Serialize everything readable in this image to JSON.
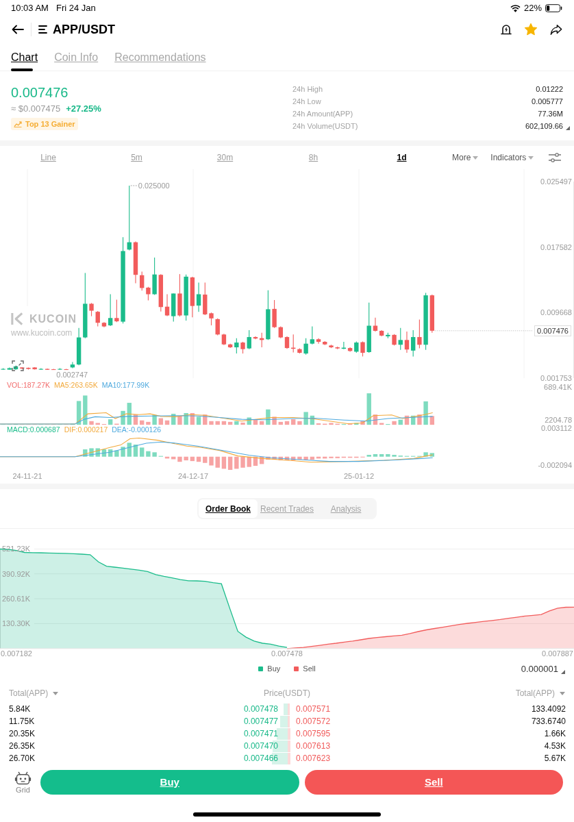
{
  "status_bar": {
    "time": "10:03 AM",
    "date": "Fri 24 Jan",
    "battery": "22%"
  },
  "header": {
    "pair": "APP/USDT",
    "favorite": true
  },
  "tabs": [
    {
      "label": "Chart",
      "selected": true
    },
    {
      "label": "Coin Info",
      "selected": false
    },
    {
      "label": "Recommendations",
      "selected": false
    }
  ],
  "ticker": {
    "last": "0.007476",
    "fiat": "≈ $0.007475",
    "change": "+27.25%",
    "badge": "Top 13 Gainer",
    "stats": [
      {
        "label": "24h High",
        "value": "0.01222"
      },
      {
        "label": "24h Low",
        "value": "0.005777"
      },
      {
        "label": "24h Amount(APP)",
        "value": "77.36M"
      },
      {
        "label": "24h Volume(USDT)",
        "value": "602,109.66"
      }
    ]
  },
  "intervals": [
    {
      "label": "Line",
      "selected": false
    },
    {
      "label": "5m",
      "selected": false
    },
    {
      "label": "30m",
      "selected": false
    },
    {
      "label": "8h",
      "selected": false
    },
    {
      "label": "1d",
      "selected": true
    }
  ],
  "chart_menus": [
    "More",
    "Indicators"
  ],
  "price_chart": {
    "chart_data": {
      "type": "candlestick",
      "categories": [
        null,
        null,
        null,
        null,
        null,
        null,
        null,
        null,
        null,
        null,
        null,
        null,
        null,
        null,
        null,
        null,
        null,
        null,
        null,
        null,
        null,
        null,
        null,
        null,
        null,
        null,
        null,
        null,
        null,
        null,
        null,
        null,
        null,
        null,
        null,
        null,
        null,
        null,
        null,
        null,
        null,
        null,
        null,
        null,
        null,
        null,
        null,
        null,
        null,
        null,
        null,
        null,
        null,
        null,
        null,
        null,
        null,
        null,
        null,
        null,
        null,
        null,
        null,
        null,
        null,
        null,
        null,
        null,
        null,
        null,
        null,
        null,
        null,
        null,
        null,
        null,
        null,
        null,
        null,
        null,
        null,
        null,
        null,
        null,
        null,
        null,
        null,
        null,
        null,
        null,
        null
      ],
      "ohlc": [
        [
          0.002777,
          0.002954,
          0.00277,
          0.002866
        ],
        [
          0.002777,
          0.003043,
          0.00276,
          0.002954
        ],
        [
          0.002822,
          0.003264,
          0.002755,
          0.003175
        ],
        [
          0.003043,
          0.003087,
          0.002822,
          0.00291
        ],
        [
          0.002999,
          0.003043,
          0.002777,
          0.002866
        ],
        [
          0.003043,
          0.003087,
          0.002777,
          0.002822
        ],
        [
          0.002777,
          0.002954,
          0.002752,
          0.002866
        ],
        [
          0.002866,
          0.00291,
          0.00275,
          0.00276
        ],
        [
          0.002822,
          0.002866,
          0.002747,
          0.00276
        ],
        [
          0.002777,
          0.002954,
          0.002755,
          0.002866
        ],
        [
          0.002822,
          0.002866,
          0.00275,
          0.002777
        ],
        [
          0.003043,
          0.003706,
          0.002954,
          0.003396
        ],
        [
          0.003396,
          0.007817,
          0.003308,
          0.006668
        ],
        [
          0.006668,
          0.014449,
          0.00658,
          0.010735
        ],
        [
          0.010735,
          0.010824,
          0.009232,
          0.009895
        ],
        [
          0.009763,
          0.009851,
          0.007994,
          0.008436
        ],
        [
          0.008436,
          0.008525,
          0.007906,
          0.007994
        ],
        [
          0.008127,
          0.011885,
          0.008039,
          0.009011
        ],
        [
          0.009011,
          0.011222,
          0.008525,
          0.008613
        ],
        [
          0.008569,
          0.018782,
          0.008348,
          0.017102
        ],
        [
          0.017278,
          0.025,
          0.01719,
          0.018163
        ],
        [
          0.018163,
          0.018251,
          0.013211,
          0.014228
        ],
        [
          0.014184,
          0.014626,
          0.012327,
          0.012637
        ],
        [
          0.012681,
          0.012769,
          0.011133,
          0.011885
        ],
        [
          0.011885,
          0.016306,
          0.011796,
          0.014272
        ],
        [
          0.014228,
          0.014316,
          0.009807,
          0.010337
        ],
        [
          0.010382,
          0.011885,
          0.009232,
          0.009321
        ],
        [
          0.009232,
          0.011973,
          0.008569,
          0.011973
        ],
        [
          0.011973,
          0.014316,
          0.009188,
          0.009321
        ],
        [
          0.009321,
          0.014272,
          0.008702,
          0.014007
        ],
        [
          0.013918,
          0.014007,
          0.0091,
          0.01047
        ],
        [
          0.010514,
          0.0133,
          0.009763,
          0.011885
        ],
        [
          0.011841,
          0.0133,
          0.009365,
          0.009453
        ],
        [
          0.009586,
          0.009674,
          0.008127,
          0.008967
        ],
        [
          0.008879,
          0.008967,
          0.006933,
          0.007022
        ],
        [
          0.007022,
          0.00711,
          0.00574,
          0.005828
        ],
        [
          0.005828,
          0.005916,
          0.005386,
          0.005474
        ],
        [
          0.005474,
          0.00658,
          0.004723,
          0.006049
        ],
        [
          0.006049,
          0.006137,
          0.004723,
          0.005253
        ],
        [
          0.005342,
          0.007552,
          0.005253,
          0.006712
        ],
        [
          0.006712,
          0.006801,
          0.006447,
          0.006535
        ],
        [
          0.00658,
          0.007243,
          0.005474,
          0.006359
        ],
        [
          0.006447,
          0.012371,
          0.006359,
          0.010072
        ],
        [
          0.010116,
          0.011177,
          0.007817,
          0.007906
        ],
        [
          0.007906,
          0.007994,
          0.00658,
          0.006668
        ],
        [
          0.006712,
          0.006801,
          0.005298,
          0.005386
        ],
        [
          0.00543,
          0.007022,
          0.004855,
          0.005298
        ],
        [
          0.005253,
          0.005342,
          0.004723,
          0.004811
        ],
        [
          0.004723,
          0.00658,
          0.00459,
          0.005916
        ],
        [
          0.005916,
          0.007994,
          0.005828,
          0.006447
        ],
        [
          0.006447,
          0.00658,
          0.005916,
          0.006137
        ],
        [
          0.006137,
          0.006226,
          0.00574,
          0.005828
        ],
        [
          0.005695,
          0.005784,
          0.005386,
          0.005474
        ],
        [
          0.005474,
          0.005563,
          0.005253,
          0.005342
        ],
        [
          0.005298,
          0.006137,
          0.005253,
          0.00543
        ],
        [
          0.005386,
          0.005474,
          0.004944,
          0.005032
        ],
        [
          0.004944,
          0.006182,
          0.004811,
          0.006049
        ],
        [
          0.006093,
          0.006182,
          0.004369,
          0.004811
        ],
        [
          0.004899,
          0.010868,
          0.004811,
          0.008083
        ],
        [
          0.008083,
          0.009055,
          0.007375,
          0.007464
        ],
        [
          0.007464,
          0.007552,
          0.006801,
          0.006889
        ],
        [
          0.006801,
          0.007243,
          0.00658,
          0.006977
        ],
        [
          0.006977,
          0.007066,
          0.005695,
          0.005784
        ],
        [
          0.005784,
          0.007817,
          0.005165,
          0.006359
        ],
        [
          0.006359,
          0.007375,
          0.004811,
          0.005209
        ],
        [
          0.005076,
          0.007552,
          0.004369,
          0.006712
        ],
        [
          0.006712,
          0.008834,
          0.005342,
          0.005784
        ],
        [
          0.005784,
          0.012062,
          0.005165,
          0.011752
        ],
        [
          0.011752,
          0.011841,
          0.007243,
          0.007476
        ],
        null,
        null,
        null,
        null,
        null,
        null,
        null,
        null,
        null,
        null,
        null,
        null,
        null,
        null,
        null,
        null,
        null,
        null,
        null,
        null,
        null,
        null
      ],
      "ylim": [
        0.001753,
        0.025497
      ],
      "yticks": [
        {
          "value": 0.025497,
          "label": "0.025497"
        },
        {
          "value": 0.017582,
          "label": "0.017582"
        },
        {
          "value": 0.009668,
          "label": "0.009668"
        },
        {
          "value": 0.001753,
          "label": "0.001753"
        }
      ],
      "ref_lines": [
        {
          "axis": "y",
          "value": 0.007476,
          "label": "0.007476"
        }
      ],
      "annotations": [
        "0.025000",
        "0.002747"
      ]
    },
    "watermark": {
      "brand": "KUCOIN",
      "url": "www.kucoin.com"
    }
  },
  "volume": {
    "readouts": [
      {
        "text": "VOL:187.27K",
        "color": "#f26b6b"
      },
      {
        "text": "MA5:263.65K",
        "color": "#f2a93b"
      },
      {
        "text": "MA10:177.99K",
        "color": "#4ea9de"
      }
    ],
    "axis_labels": [
      "689.41K",
      "2204.78"
    ]
  },
  "macd": {
    "readouts": [
      {
        "text": "MACD:0.000687",
        "color": "#1bbc8b"
      },
      {
        "text": "DIF:0.000217",
        "color": "#f2a93b"
      },
      {
        "text": "DEA:-0.000126",
        "color": "#4ea9de"
      }
    ],
    "axis_labels": [
      "0.003112",
      "-0.002094"
    ]
  },
  "dates": [
    "24-11-21",
    "24-12-17",
    "25-01-12"
  ],
  "book_tabs": [
    {
      "label": "Order Book",
      "selected": true
    },
    {
      "label": "Recent Trades",
      "selected": false
    },
    {
      "label": "Analysis",
      "selected": false
    }
  ],
  "depth_chart": {
    "chart_data": {
      "type": "area",
      "categories": [
        null,
        null,
        "0.007182",
        null,
        null,
        null,
        null,
        null,
        null,
        null,
        null,
        null,
        null,
        null,
        null,
        null,
        null,
        null,
        null,
        null,
        null,
        null,
        null,
        null,
        null,
        null,
        null,
        null,
        null,
        null,
        null,
        null,
        null,
        null,
        null,
        "0.007478",
        null,
        null,
        null,
        null,
        null,
        null,
        null,
        null,
        null,
        null,
        null,
        null,
        null,
        null,
        null,
        null,
        null,
        null,
        null,
        null,
        null,
        null,
        null,
        null,
        null,
        null,
        null,
        null,
        null,
        null,
        null,
        null,
        "0.007887",
        null,
        null
      ],
      "series": [
        {
          "name": "Buy",
          "color": "#1bbc8b",
          "values": [
            521,
            519,
            513,
            503,
            502,
            501,
            500,
            499,
            498,
            496,
            494,
            491,
            454,
            431,
            426,
            421,
            416,
            410,
            403,
            387,
            378,
            370,
            361,
            355,
            354,
            352,
            345,
            339,
            213,
            90,
            60,
            39,
            28,
            23,
            13,
            6,
            null,
            null,
            null,
            null,
            null,
            null,
            null,
            null,
            null,
            null,
            null,
            null,
            null,
            null,
            null,
            null,
            null,
            null,
            null,
            null,
            null,
            null,
            null,
            null,
            null,
            null,
            null,
            null,
            null,
            null,
            null,
            null,
            null,
            null,
            null
          ]
        },
        {
          "name": "Sell",
          "color": "#f25c5c",
          "values": [
            null,
            null,
            null,
            null,
            null,
            null,
            null,
            null,
            null,
            null,
            null,
            null,
            null,
            null,
            null,
            null,
            null,
            null,
            null,
            null,
            null,
            null,
            null,
            null,
            null,
            null,
            null,
            null,
            null,
            null,
            null,
            null,
            null,
            null,
            null,
            0,
            3,
            6,
            11,
            17,
            23,
            28,
            34,
            39,
            46,
            53,
            58,
            62,
            66,
            70,
            79,
            89,
            98,
            105,
            112,
            119,
            126,
            132,
            137,
            142,
            147,
            152,
            158,
            164,
            170,
            174,
            178,
            197,
            211,
            216,
            217
          ]
        }
      ],
      "ylim": [
        0,
        521.23
      ],
      "yticks": [
        {
          "value": 130.3,
          "label": "130.30K"
        },
        {
          "value": 260.61,
          "label": "260.61K"
        },
        {
          "value": 390.92,
          "label": "390.92K"
        },
        {
          "value": 521.23,
          "label": "521.23K"
        }
      ],
      "grid": true,
      "legend": "bottom"
    }
  },
  "precision": "0.000001",
  "order_book": {
    "columns": [
      {
        "label": "Total(APP)",
        "kind": "dropdown"
      },
      {
        "label": "Price(USDT)",
        "kind": "plain"
      },
      {
        "label": "Total(APP)",
        "kind": "dropdown"
      }
    ],
    "rows": [
      {
        "bid_total": "5.84K",
        "bid": "0.007478",
        "ask": "0.007571",
        "ask_total": "133.4092"
      },
      {
        "bid_total": "11.75K",
        "bid": "0.007477",
        "ask": "0.007572",
        "ask_total": "733.6740"
      },
      {
        "bid_total": "20.35K",
        "bid": "0.007471",
        "ask": "0.007595",
        "ask_total": "1.66K"
      },
      {
        "bid_total": "26.35K",
        "bid": "0.007470",
        "ask": "0.007613",
        "ask_total": "4.53K"
      },
      {
        "bid_total": "26.70K",
        "bid": "0.007466",
        "ask": "0.007623",
        "ask_total": "5.67K"
      }
    ]
  },
  "actions": {
    "grid": "Grid",
    "buy": "Buy",
    "sell": "Sell"
  }
}
